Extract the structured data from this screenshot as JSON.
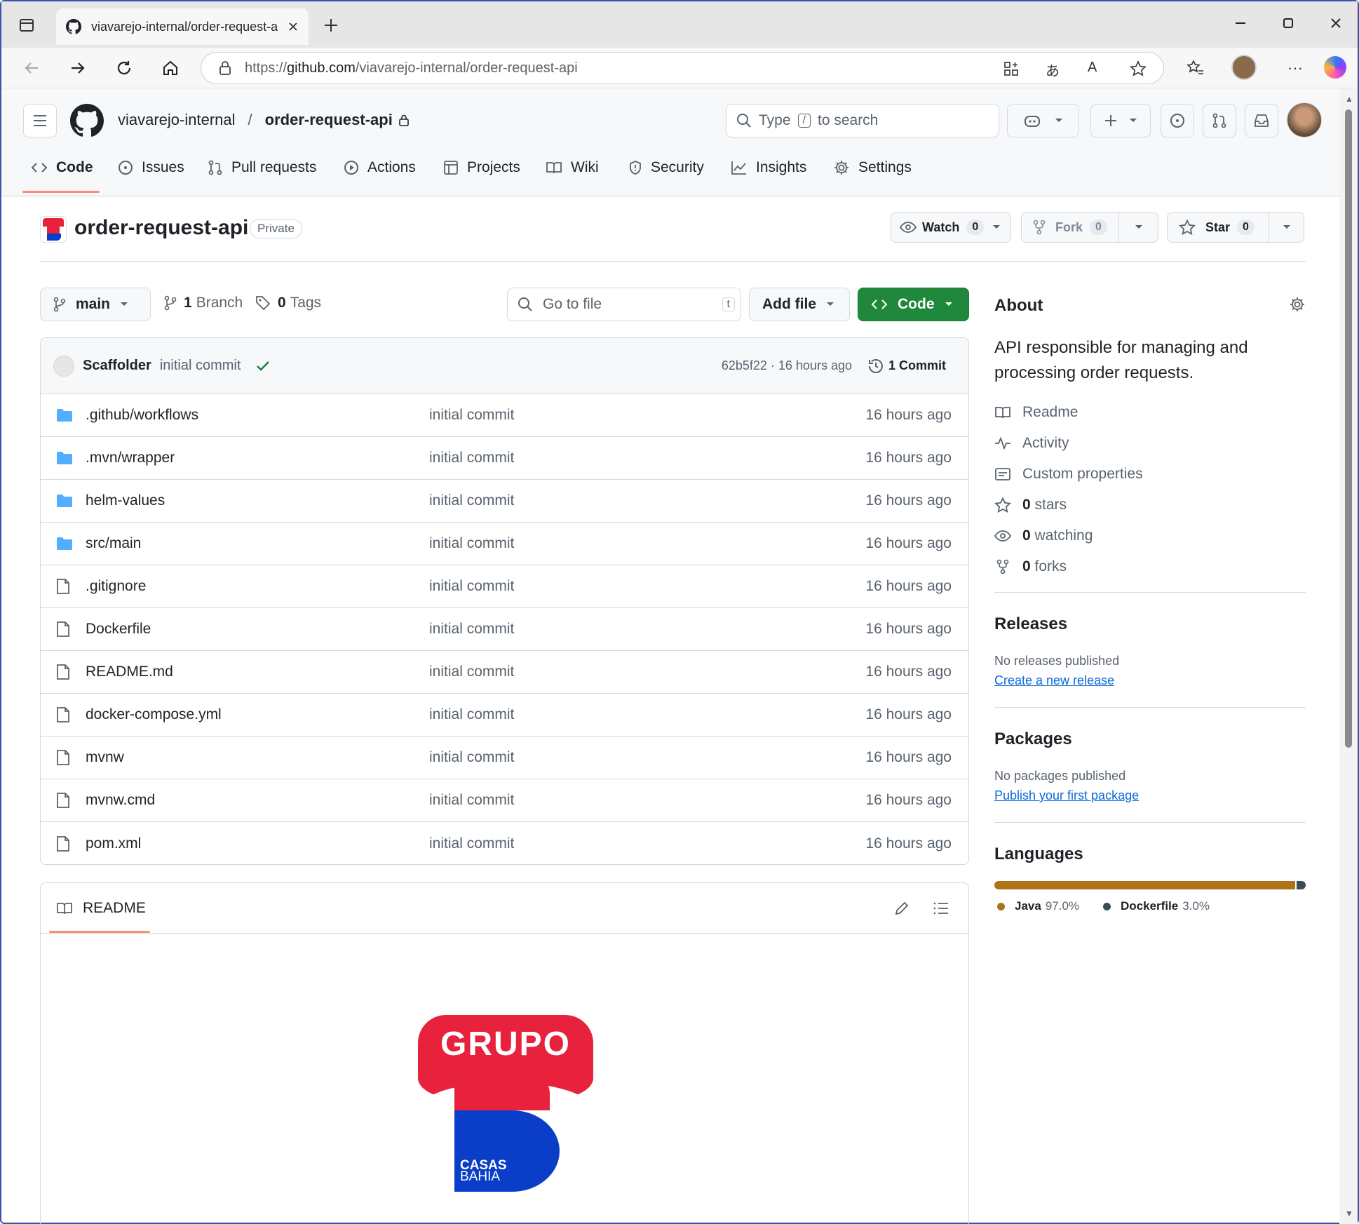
{
  "browser": {
    "tab_title": "viavarejo-internal/order-request-a",
    "url_prefix": "https://",
    "url_host": "github.com",
    "url_path": "/viavarejo-internal/order-request-api"
  },
  "header": {
    "owner": "viavarejo-internal",
    "separator": "/",
    "repo": "order-request-api",
    "search_type": "Type",
    "search_key": "/",
    "search_rest": "to search"
  },
  "nav": {
    "code": "Code",
    "issues": "Issues",
    "pulls": "Pull requests",
    "actions": "Actions",
    "projects": "Projects",
    "wiki": "Wiki",
    "security": "Security",
    "insights": "Insights",
    "settings": "Settings"
  },
  "repo": {
    "name": "order-request-api",
    "visibility": "Private",
    "watch_label": "Watch",
    "watch_count": "0",
    "fork_label": "Fork",
    "fork_count": "0",
    "star_label": "Star",
    "star_count": "0"
  },
  "toolbar": {
    "branch": "main",
    "branch_count": "1",
    "branch_label": "Branch",
    "tag_count": "0",
    "tag_label": "Tags",
    "goto_placeholder": "Go to file",
    "goto_key": "t",
    "add_file": "Add file",
    "code_btn": "Code"
  },
  "commit": {
    "author": "Scaffolder",
    "message": "initial commit",
    "sha_time": "62b5f22 · 16 hours ago",
    "count": "1 Commit"
  },
  "files": [
    {
      "name": ".github/workflows",
      "type": "dir",
      "message": "initial commit",
      "time": "16 hours ago"
    },
    {
      "name": ".mvn/wrapper",
      "type": "dir",
      "message": "initial commit",
      "time": "16 hours ago"
    },
    {
      "name": "helm-values",
      "type": "dir",
      "message": "initial commit",
      "time": "16 hours ago"
    },
    {
      "name": "src/main",
      "type": "dir",
      "message": "initial commit",
      "time": "16 hours ago"
    },
    {
      "name": ".gitignore",
      "type": "file",
      "message": "initial commit",
      "time": "16 hours ago"
    },
    {
      "name": "Dockerfile",
      "type": "file",
      "message": "initial commit",
      "time": "16 hours ago"
    },
    {
      "name": "README.md",
      "type": "file",
      "message": "initial commit",
      "time": "16 hours ago"
    },
    {
      "name": "docker-compose.yml",
      "type": "file",
      "message": "initial commit",
      "time": "16 hours ago"
    },
    {
      "name": "mvnw",
      "type": "file",
      "message": "initial commit",
      "time": "16 hours ago"
    },
    {
      "name": "mvnw.cmd",
      "type": "file",
      "message": "initial commit",
      "time": "16 hours ago"
    },
    {
      "name": "pom.xml",
      "type": "file",
      "message": "initial commit",
      "time": "16 hours ago"
    }
  ],
  "readme": {
    "title": "README",
    "logo_top": "GRUPO",
    "logo_line1": "CASAS",
    "logo_line2": "BAHIA"
  },
  "about": {
    "title": "About",
    "description_line1": "API responsible for managing and",
    "description_line2": "processing order requests.",
    "readme": "Readme",
    "activity": "Activity",
    "custom_properties": "Custom properties",
    "stars_count": "0",
    "stars_label": "stars",
    "watching_count": "0",
    "watching_label": "watching",
    "forks_count": "0",
    "forks_label": "forks"
  },
  "releases": {
    "title": "Releases",
    "empty": "No releases published",
    "link": "Create a new release"
  },
  "packages": {
    "title": "Packages",
    "empty": "No packages published",
    "link": "Publish your first package"
  },
  "languages": {
    "title": "Languages",
    "items": [
      {
        "name": "Java",
        "percent": "97.0%",
        "value": 97.0,
        "color": "#b07219"
      },
      {
        "name": "Dockerfile",
        "percent": "3.0%",
        "value": 3.0,
        "color": "#384d54"
      }
    ]
  },
  "colors": {
    "primary_button": "#1f883d",
    "link": "#0969da",
    "folder": "#54aeff",
    "tab_underline": "#fd8c73"
  }
}
